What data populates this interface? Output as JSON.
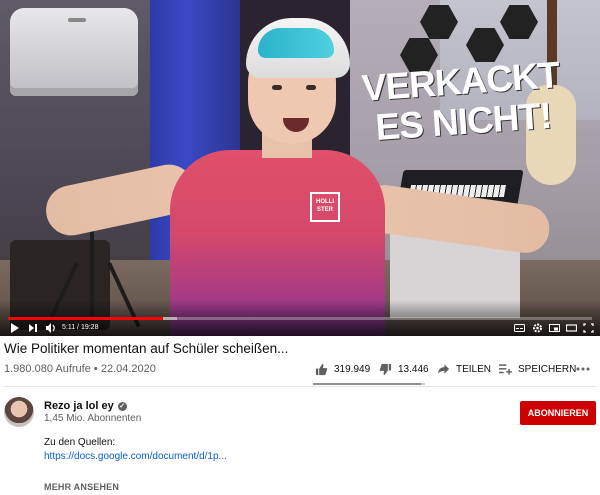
{
  "player": {
    "overlay_text_line1": "VERKACKT",
    "overlay_text_line2": "ES NICHT!",
    "shirt_logo": "HOLLI STER",
    "time_display": "5:11 / 19:28",
    "progress_played_fraction": 0.266,
    "progress_buffered_fraction": 0.29
  },
  "video": {
    "title": "Wie Politiker momentan auf Schüler scheißen...",
    "views": "1.980.080 Aufrufe",
    "date": "22.04.2020",
    "likes": "319.949",
    "dislikes": "13.446",
    "share_label": "TEILEN",
    "save_label": "SPEICHERN",
    "like_ratio": 0.96
  },
  "channel": {
    "name": "Rezo ja lol ey",
    "subscribers": "1,45 Mio. Abonnenten",
    "subscribe_label": "ABONNIEREN"
  },
  "description": {
    "line1": "Zu den Quellen:",
    "link": "https://docs.google.com/document/d/1p...",
    "more_label": "MEHR ANSEHEN"
  },
  "colors": {
    "accent_red": "#cc0000",
    "progress_red": "#ff0000",
    "link_blue": "#065fd4"
  }
}
